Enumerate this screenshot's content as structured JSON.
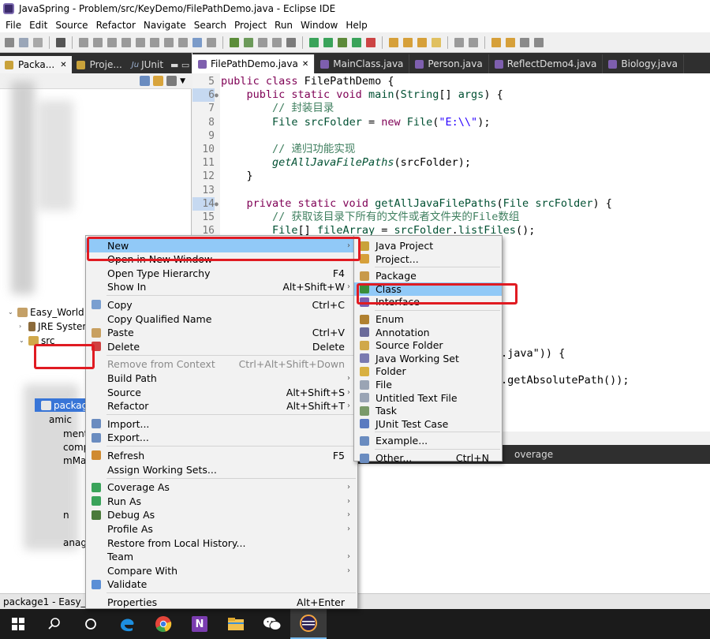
{
  "window": {
    "title": "JavaSpring - Problem/src/KeyDemo/FilePathDemo.java - Eclipse IDE"
  },
  "menubar": {
    "items": [
      "File",
      "Edit",
      "Source",
      "Refactor",
      "Navigate",
      "Search",
      "Project",
      "Run",
      "Window",
      "Help"
    ]
  },
  "left_view": {
    "tabs": [
      {
        "label": "Packa...",
        "icon": "package-explorer-icon",
        "close": "✕"
      },
      {
        "label": "Proje...",
        "icon": "project-explorer-icon"
      },
      {
        "label": "JUnit",
        "prefix": "Ju",
        "icon": "junit-icon"
      }
    ],
    "tree": [
      {
        "label": "Easy_World",
        "icon": "project-folder-icon"
      },
      {
        "label": "JRE System",
        "icon": "library-icon"
      },
      {
        "label": "src",
        "icon": "source-folder-icon"
      },
      {
        "label": "package",
        "icon": "package-icon"
      },
      {
        "label": "amic"
      },
      {
        "label": "ment"
      },
      {
        "label": "comp"
      },
      {
        "label": "mMar"
      },
      {
        "label": "n"
      },
      {
        "label": "anage"
      }
    ]
  },
  "editor": {
    "tabs": [
      {
        "label": "FilePathDemo.java",
        "close": "✕",
        "active": true
      },
      {
        "label": "MainClass.java"
      },
      {
        "label": "Person.java"
      },
      {
        "label": "ReflectDemo4.java"
      },
      {
        "label": "Biology.java"
      }
    ],
    "lines": [
      {
        "n": "5",
        "html": "<span class=\"kw\">public class</span> FilePathDemo {"
      },
      {
        "n": "6",
        "mark": "●",
        "html": "    <span class=\"kw\">public static void</span> <span class=\"ty\">main</span>(<span class=\"ty\">String</span>[] <span class=\"ty\">args</span>) {"
      },
      {
        "n": "7",
        "html": "        <span class=\"cm\">// 封装目录</span>"
      },
      {
        "n": "8",
        "html": "        <span class=\"ty\">File</span> <span class=\"ty\">srcFolder</span> = <span class=\"kw\">new</span> <span class=\"ty\">File</span>(<span class=\"st\">\"E:\\\\\"</span>);"
      },
      {
        "n": "9",
        "html": ""
      },
      {
        "n": "10",
        "html": "        <span class=\"cm\">// 递归功能实现</span>"
      },
      {
        "n": "11",
        "html": "        <span class=\"it ty\">getAllJavaFilePaths</span>(srcFolder);"
      },
      {
        "n": "12",
        "html": "    }"
      },
      {
        "n": "13",
        "html": ""
      },
      {
        "n": "14",
        "mark": "●",
        "html": "    <span class=\"kw\">private static void</span> <span class=\"ty\">getAllJavaFilePaths</span>(<span class=\"ty\">File</span> <span class=\"ty\">srcFolder</span>) {"
      },
      {
        "n": "15",
        "html": "        <span class=\"cm\">// 获取该目录下所有的文件或者文件夹的File数组</span>"
      },
      {
        "n": "16",
        "html": "        <span class=\"ty\">File</span>[] <span class=\"ty\">fileArray</span> = <span class=\"ty\">srcFolder</span>.<span class=\"ty\">listFiles</span>();"
      }
    ],
    "behind_menu": [
      ".java\")) {",
      ".getAbsolutePath());"
    ]
  },
  "console": {
    "tab_partial": "overage"
  },
  "context_menu": {
    "items": [
      {
        "label": "New",
        "submenu": true,
        "highlight": true
      },
      {
        "label": "Open in New Window"
      },
      {
        "label": "Open Type Hierarchy",
        "shortcut": "F4"
      },
      {
        "label": "Show In",
        "shortcut": "Alt+Shift+W",
        "submenu": true
      },
      {
        "sep": true
      },
      {
        "label": "Copy",
        "shortcut": "Ctrl+C",
        "icon": "copy-icon"
      },
      {
        "label": "Copy Qualified Name"
      },
      {
        "label": "Paste",
        "shortcut": "Ctrl+V",
        "icon": "paste-icon"
      },
      {
        "label": "Delete",
        "shortcut": "Delete",
        "icon": "delete-icon"
      },
      {
        "sep": true
      },
      {
        "label": "Remove from Context",
        "shortcut": "Ctrl+Alt+Shift+Down",
        "disabled": true
      },
      {
        "label": "Build Path",
        "submenu": true
      },
      {
        "label": "Source",
        "shortcut": "Alt+Shift+S",
        "submenu": true
      },
      {
        "label": "Refactor",
        "shortcut": "Alt+Shift+T",
        "submenu": true
      },
      {
        "sep": true
      },
      {
        "label": "Import...",
        "icon": "import-icon"
      },
      {
        "label": "Export...",
        "icon": "export-icon"
      },
      {
        "sep": true
      },
      {
        "label": "Refresh",
        "shortcut": "F5",
        "icon": "refresh-icon"
      },
      {
        "label": "Assign Working Sets..."
      },
      {
        "sep": true
      },
      {
        "label": "Coverage As",
        "submenu": true,
        "icon": "coverage-icon"
      },
      {
        "label": "Run As",
        "submenu": true,
        "icon": "run-icon"
      },
      {
        "label": "Debug As",
        "submenu": true,
        "icon": "debug-icon"
      },
      {
        "label": "Profile As",
        "submenu": true
      },
      {
        "label": "Restore from Local History..."
      },
      {
        "label": "Team",
        "submenu": true
      },
      {
        "label": "Compare With",
        "submenu": true
      },
      {
        "label": "Validate",
        "icon": "validate-checkbox-icon"
      },
      {
        "sep": true
      },
      {
        "label": "Properties",
        "shortcut": "Alt+Enter"
      }
    ]
  },
  "submenu": {
    "items": [
      {
        "label": "Java Project",
        "icon": "java-project-icon"
      },
      {
        "label": "Project...",
        "icon": "project-icon"
      },
      {
        "sep": true
      },
      {
        "label": "Package",
        "icon": "new-package-icon"
      },
      {
        "label": "Class",
        "icon": "class-icon",
        "highlight": true
      },
      {
        "label": "Interface",
        "icon": "interface-icon"
      },
      {
        "sep": true
      },
      {
        "label": "Enum",
        "icon": "enum-icon"
      },
      {
        "label": "Annotation",
        "icon": "annotation-icon"
      },
      {
        "label": "Source Folder",
        "icon": "source-folder-new-icon"
      },
      {
        "label": "Java Working Set",
        "icon": "working-set-icon"
      },
      {
        "label": "Folder",
        "icon": "folder-icon"
      },
      {
        "label": "File",
        "icon": "file-icon"
      },
      {
        "label": "Untitled Text File",
        "icon": "text-file-icon"
      },
      {
        "label": "Task",
        "icon": "task-icon"
      },
      {
        "label": "JUnit Test Case",
        "icon": "junit-test-case-icon"
      },
      {
        "sep": true
      },
      {
        "label": "Example...",
        "icon": "example-icon"
      },
      {
        "sep": true
      },
      {
        "label": "Other...",
        "shortcut": "Ctrl+N",
        "icon": "other-wizard-icon"
      }
    ]
  },
  "statusbar": {
    "text": "package1 - Easy_Wo"
  },
  "taskbar": {
    "items": [
      {
        "name": "windows-start-icon"
      },
      {
        "name": "search-icon"
      },
      {
        "name": "task-view-icon"
      },
      {
        "name": "edge-browser-icon"
      },
      {
        "name": "chrome-icon"
      },
      {
        "name": "onenote-icon",
        "letter": "N"
      },
      {
        "name": "file-explorer-icon"
      },
      {
        "name": "wechat-icon"
      },
      {
        "name": "eclipse-icon",
        "active": true
      }
    ]
  },
  "colors": {
    "accent_highlight": "#91c9f7",
    "annotation_red": "#e01b22",
    "tab_bar_dark": "#2f2f2f"
  }
}
